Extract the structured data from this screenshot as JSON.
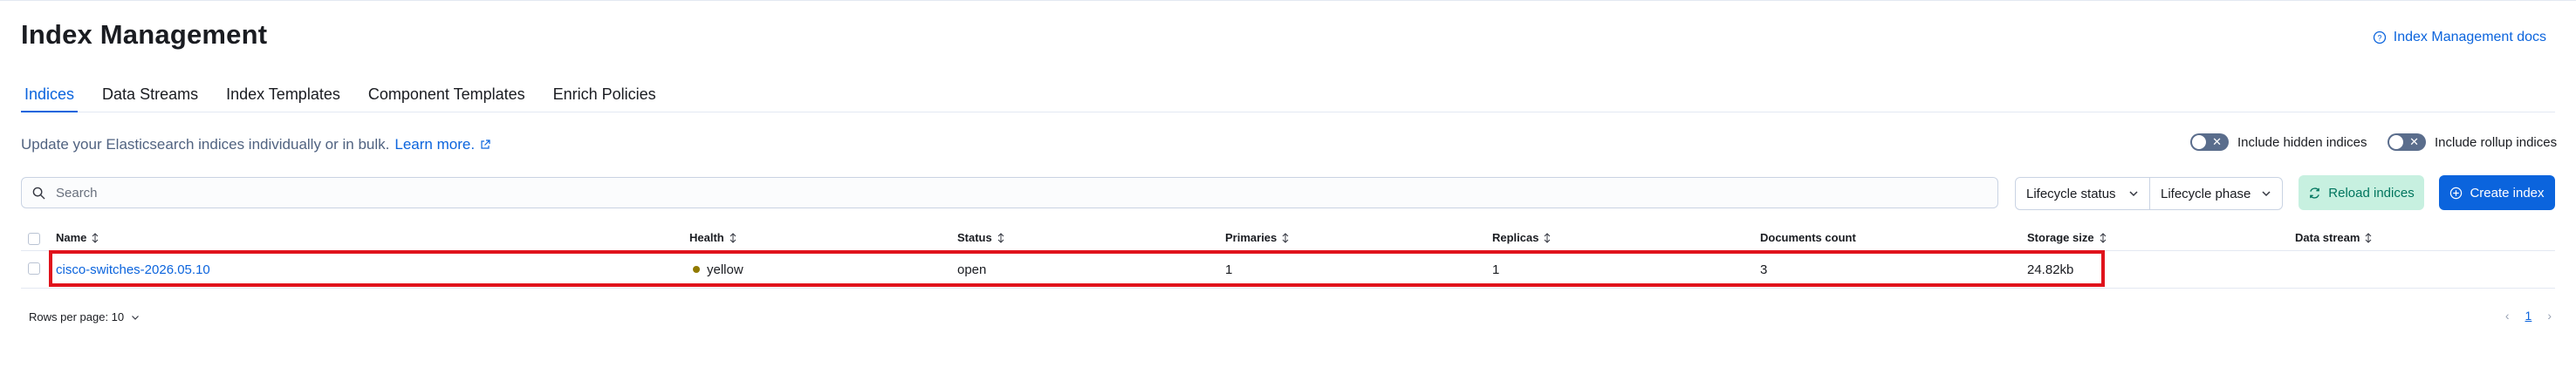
{
  "header": {
    "title": "Index Management",
    "docs_link": "Index Management docs"
  },
  "tabs": [
    {
      "label": "Indices",
      "active": true
    },
    {
      "label": "Data Streams"
    },
    {
      "label": "Index Templates"
    },
    {
      "label": "Component Templates"
    },
    {
      "label": "Enrich Policies"
    }
  ],
  "description": {
    "text": "Update your Elasticsearch indices individually or in bulk.",
    "learn_more": "Learn more."
  },
  "toggles": {
    "hidden": "Include hidden indices",
    "rollup": "Include rollup indices"
  },
  "search": {
    "placeholder": "Search"
  },
  "filters": {
    "lifecycle_status": "Lifecycle status",
    "lifecycle_phase": "Lifecycle phase"
  },
  "buttons": {
    "reload": "Reload indices",
    "create": "Create index"
  },
  "table": {
    "columns": [
      "Name",
      "Health",
      "Status",
      "Primaries",
      "Replicas",
      "Documents count",
      "Storage size",
      "Data stream"
    ],
    "rows": [
      {
        "name": "cisco-switches-2026.05.10",
        "health": "yellow",
        "status": "open",
        "primaries": "1",
        "replicas": "1",
        "documents_count": "3",
        "storage_size": "24.82kb",
        "data_stream": ""
      }
    ]
  },
  "pagination": {
    "rows_per_page": "Rows per page: 10",
    "current_page": "1"
  },
  "colors": {
    "accent": "#0b64dd",
    "health_yellow": "#917a00",
    "highlight": "#e0131c",
    "reload_bg": "#c7f0e0"
  }
}
